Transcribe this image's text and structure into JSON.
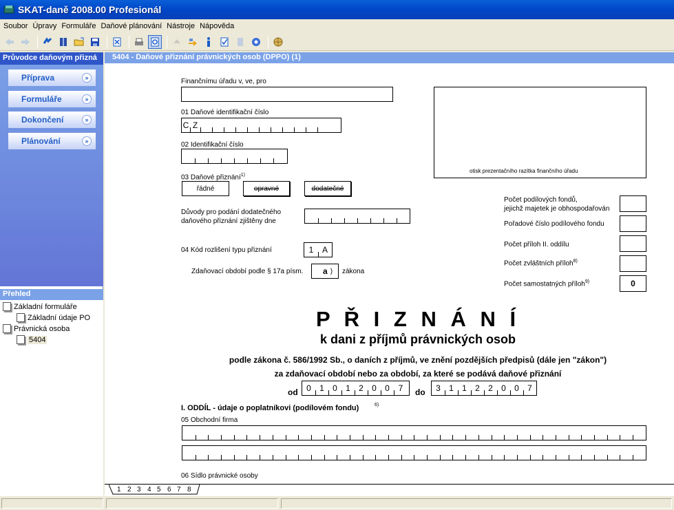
{
  "window": {
    "title": "SKAT-daně 2008.00 Profesionál"
  },
  "menu": [
    "Soubor",
    "Úpravy",
    "Formuláře",
    "Daňové plánování",
    "Nástroje",
    "Nápověda"
  ],
  "toolbar": {
    "icons": [
      "back-arrow-icon",
      "forward-arrow-icon",
      "refresh-icon",
      "book-icon",
      "open-folder-icon",
      "save-icon",
      "close-document-icon",
      "print-icon",
      "print-preview-icon",
      "export-icon",
      "transfer-icon",
      "info-icon",
      "check-document-icon",
      "list-icon",
      "settings-icon",
      "globe-icon"
    ]
  },
  "wizard": {
    "header": "Průvodce daňovým přizná",
    "items": [
      "Příprava",
      "Formuláře",
      "Dokončení",
      "Plánování"
    ]
  },
  "overview": {
    "header": "Přehled",
    "tree": [
      {
        "label": "Základní formuláře",
        "level": 0
      },
      {
        "label": "Základní údaje PO",
        "level": 1
      },
      {
        "label": "Právnická osoba",
        "level": 0
      },
      {
        "label": "5404",
        "level": 1
      }
    ]
  },
  "document": {
    "header": "5404 - Daňové přiznání právnických osob (DPPO) (1)",
    "fields": {
      "financni_urad": "Finančnímu úřadu v, ve, pro",
      "dic_label": "01 Daňové identifikační číslo",
      "dic_prefix": [
        "C",
        "Z"
      ],
      "ic_label": "02 Identifikační číslo",
      "priznani_label": "03 Daňové přiznání",
      "priznani_sup": "1)",
      "priznani_options": [
        "řádné",
        "opravné",
        "dodatečné"
      ],
      "duvody_label_1": "Důvody pro podání dodatečného",
      "duvody_label_2": "daňového přiznání zjištěny dne",
      "kod_label": "04 Kód rozlišení typu přiznání",
      "kod_value": [
        "1",
        "A"
      ],
      "zdanovaci_label": "Zdaňovací období podle § 17a písm.",
      "zdanovaci_value": "a",
      "zdanovaci_suffix": "zákona",
      "stamp_label": "otisk prezentačního razítka finančního úřadu",
      "right_1a": "Počet podílových fondů,",
      "right_1b": "jejichž majetek je obhospodařován",
      "right_2": "Pořadové číslo podílového fondu",
      "right_3": "Počet příloh II. oddílu",
      "right_4": "Počet zvláštních příloh",
      "right_4_sup": "8)",
      "right_5": "Počet samostatných příloh",
      "right_5_sup": "9)",
      "right_5_value": "0"
    },
    "title": "P Ř I Z N Á N Í",
    "subtitle": "k dani z příjmů právnických osob",
    "law_line": "podle zákona č. 586/1992 Sb., o daních z příjmů, ve znění pozdějších předpisů (dále jen \"zákon\")",
    "period_line": "za zdaňovací období nebo za období, za které se podává daňové přiznání",
    "od_label": "od",
    "od_value": [
      "0",
      "1",
      "0",
      "1",
      "2",
      "0",
      "0",
      "7"
    ],
    "do_label": "do",
    "do_value": [
      "3",
      "1",
      "1",
      "2",
      "2",
      "0",
      "0",
      "7"
    ],
    "section_title": "I. ODDÍL - údaje o poplatníkovi (podílovém fondu)",
    "section_sup": "6)",
    "obchodni_firma_label": "05 Obchodní firma",
    "sidlo_label": "06 Sídlo právnické osoby"
  },
  "tabs": [
    "1",
    "2",
    "3",
    "4",
    "5",
    "6",
    "7",
    "8"
  ]
}
